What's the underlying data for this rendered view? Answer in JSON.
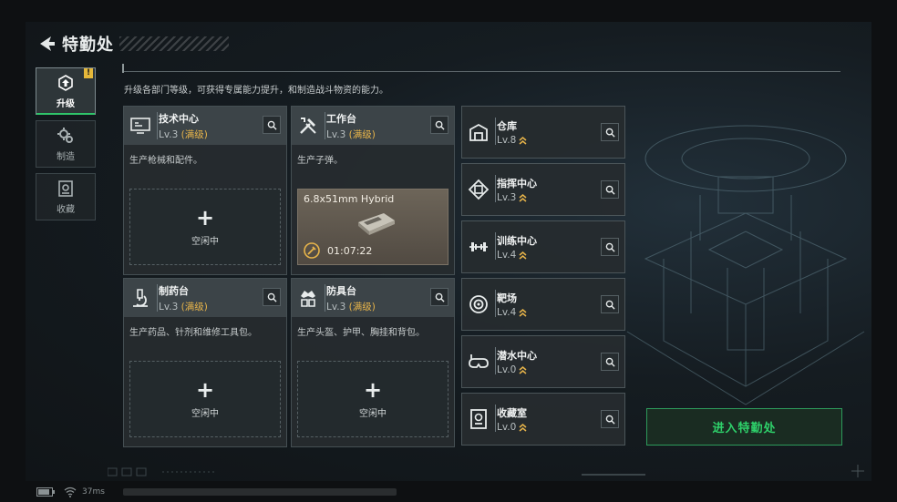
{
  "header": {
    "title": "特勤处",
    "back_icon": "back-arrow-icon"
  },
  "intro": "升级各部门等级，可获得专属能力提升，和制造战斗物资的能力。",
  "nav": [
    {
      "label": "升级",
      "icon": "upgrade-icon",
      "active": true,
      "badge": "!"
    },
    {
      "label": "制造",
      "icon": "gears-icon",
      "active": false
    },
    {
      "label": "收藏",
      "icon": "collection-icon",
      "active": false
    }
  ],
  "cards": [
    {
      "name": "技术中心",
      "level": "Lv.3",
      "max": "(满级)",
      "desc": "生产枪械和配件。",
      "icon": "monitor-icon",
      "slot": {
        "type": "idle",
        "text": "空闲中",
        "plus": "+"
      }
    },
    {
      "name": "工作台",
      "level": "Lv.3",
      "max": "(满级)",
      "desc": "生产子弹。",
      "icon": "tools-icon",
      "slot": {
        "type": "crafting",
        "item": "6.8x51mm Hybrid",
        "time": "01:07:22",
        "item_icon": "ammo-box-icon"
      }
    },
    {
      "name": "制药台",
      "level": "Lv.3",
      "max": "(满级)",
      "desc": "生产药品、针剂和维修工具包。",
      "icon": "microscope-icon",
      "slot": {
        "type": "idle",
        "text": "空闲中",
        "plus": "+"
      }
    },
    {
      "name": "防具台",
      "level": "Lv.3",
      "max": "(满级)",
      "desc": "生产头盔、护甲、胸挂和背包。",
      "icon": "armor-icon",
      "slot": {
        "type": "idle",
        "text": "空闲中",
        "plus": "+"
      }
    }
  ],
  "rooms": [
    {
      "name": "仓库",
      "level": "Lv.8",
      "icon": "warehouse-icon"
    },
    {
      "name": "指挥中心",
      "level": "Lv.3",
      "icon": "chip-icon"
    },
    {
      "name": "训练中心",
      "level": "Lv.4",
      "icon": "dumbbell-icon"
    },
    {
      "name": "靶场",
      "level": "Lv.4",
      "icon": "target-icon"
    },
    {
      "name": "潜水中心",
      "level": "Lv.0",
      "icon": "diving-mask-icon"
    },
    {
      "name": "收藏室",
      "level": "Lv.0",
      "icon": "collection-room-icon"
    }
  ],
  "enter_button": "进入特勤处",
  "status": {
    "ping": "37ms"
  },
  "colors": {
    "accent_green": "#2ed06a",
    "max_gold": "#e7b44a",
    "badge_yellow": "#e6b83a",
    "craft_slot": "#6d6559"
  }
}
